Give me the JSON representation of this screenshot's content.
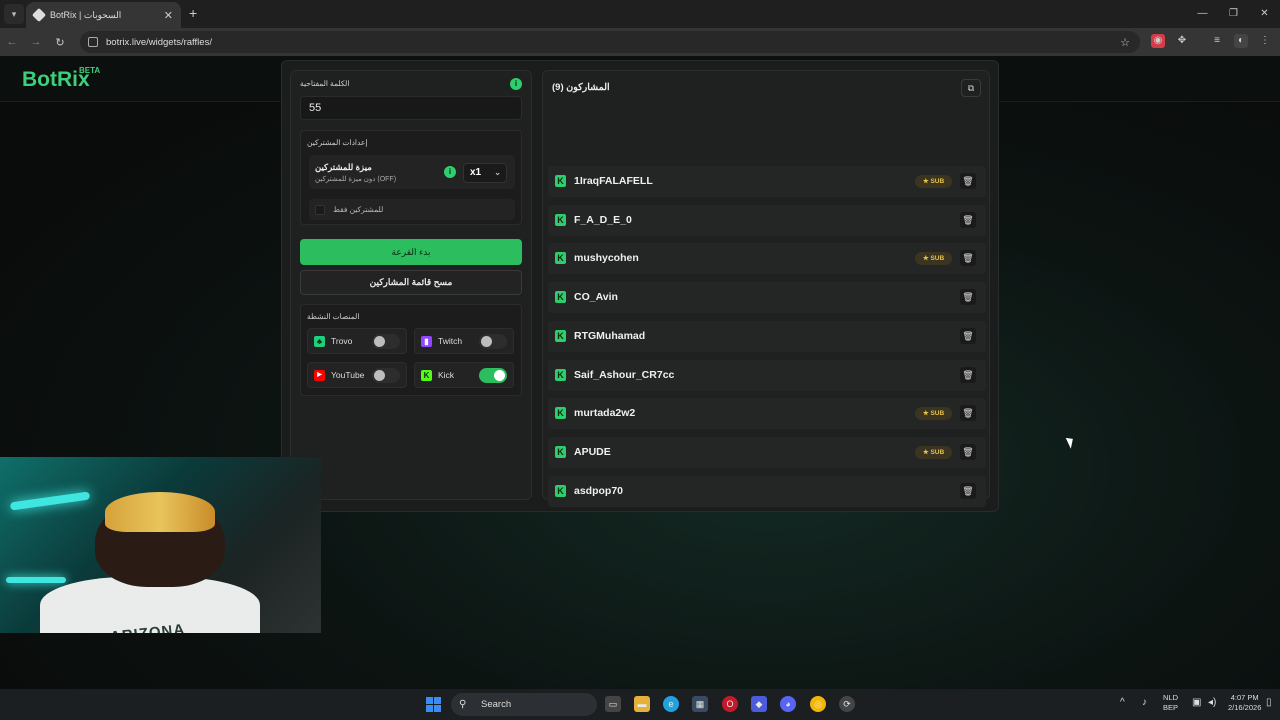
{
  "browser": {
    "tab_title": "BotRix | السحوبات",
    "url": "botrix.live/widgets/raffles/"
  },
  "header": {
    "logo": "BotRix",
    "beta": "BETA"
  },
  "settings": {
    "keyword_label": "الكلمة المفتاحية",
    "keyword_value": "55",
    "info_icon": "i",
    "subscriber_settings_title": "إعدادات المشتركين",
    "sub_feature_title": "ميزة للمشتركين",
    "sub_feature_sub": "دون ميزة للمشتركين (OFF)",
    "multiplier": "x1",
    "subscribers_only": "للمشتركين فقط",
    "start_button": "بدء القرعة",
    "clear_button": "مسح قائمة المشاركين",
    "platforms_title": "المنصات النشطة",
    "platforms": [
      {
        "name": "Trovo",
        "enabled": false,
        "color": "#1fd07b"
      },
      {
        "name": "Twitch",
        "enabled": false,
        "color": "#9146ff"
      },
      {
        "name": "YouTube",
        "enabled": false,
        "color": "#ff0000"
      },
      {
        "name": "Kick",
        "enabled": true,
        "color": "#53fc18"
      }
    ]
  },
  "participants": {
    "title": "المشاركون (9)",
    "sub_badge": "SUB",
    "list": [
      {
        "name": "1IraqFALAFELL",
        "sub": true
      },
      {
        "name": "F_A_D_E_0",
        "sub": false
      },
      {
        "name": "mushycohen",
        "sub": true
      },
      {
        "name": "CO_Avin",
        "sub": false
      },
      {
        "name": "RTGMuhamad",
        "sub": false
      },
      {
        "name": "Saif_Ashour_CR7cc",
        "sub": false
      },
      {
        "name": "murtada2w2",
        "sub": true
      },
      {
        "name": "APUDE",
        "sub": true
      },
      {
        "name": "asdpop70",
        "sub": false
      }
    ]
  },
  "webcam": {
    "shirt_text": "ARIZONA"
  },
  "taskbar": {
    "search": "Search",
    "lang": "NLD",
    "lang2": "BEP",
    "time": "4:07 PM",
    "date": "2/16/2026"
  },
  "colors": {
    "accent": "#2bbd5e",
    "sub_badge": "#e6c34a"
  }
}
